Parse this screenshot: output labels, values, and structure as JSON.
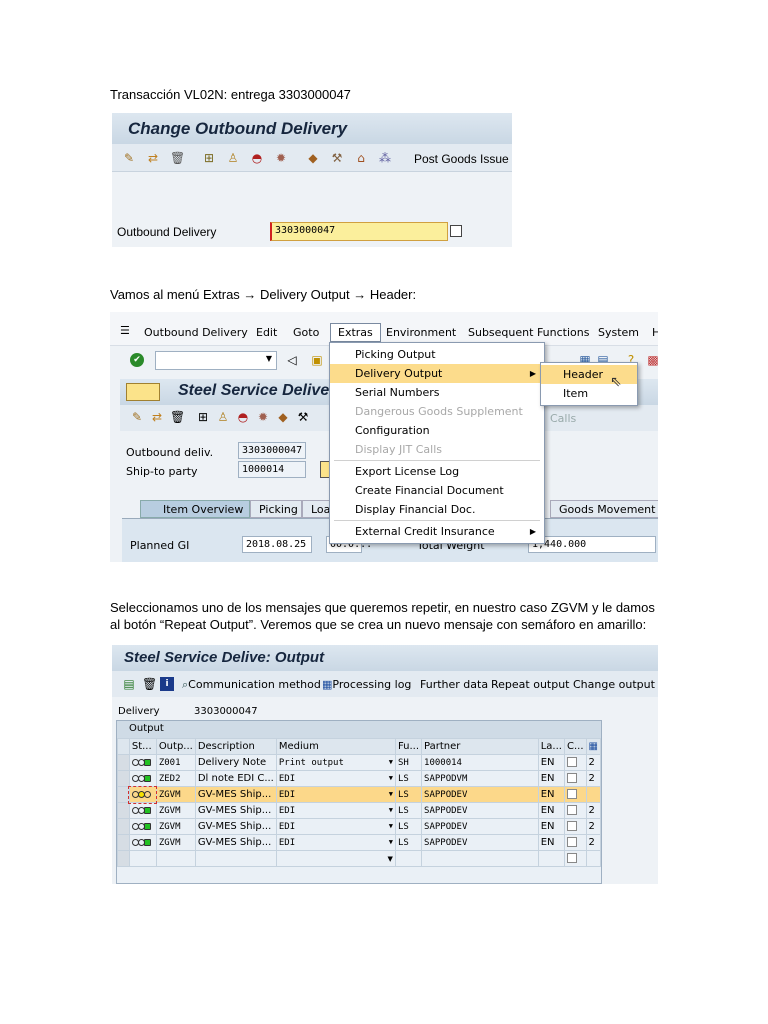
{
  "para1": "Transacción VL02N: entrega 3303000047",
  "shot1": {
    "title": "Change Outbound Delivery",
    "toolbar_icons": [
      "pencil-icon",
      "other-object-icon",
      "trash-icon",
      "document-flow-icon",
      "person-icon",
      "hat-icon",
      "fire-icon",
      "box-icon",
      "picking-icon",
      "house-icon",
      "grid-icon"
    ],
    "post_goods_issue": "Post Goods Issue",
    "field_label": "Outbound Delivery",
    "field_value": "3303000047"
  },
  "para2": "Vamos al menú Extras → Delivery Output → Header:",
  "shot2": {
    "menubar": [
      "Outbound Delivery",
      "Edit",
      "Goto",
      "Extras",
      "Environment",
      "Subsequent Functions",
      "System",
      "H"
    ],
    "title": "Steel Service Delive",
    "outbound_label": "Outbound deliv.",
    "outbound_value": "3303000047",
    "shipto_label": "Ship-to party",
    "shipto_value": "1000014",
    "tabs": [
      "Item Overview",
      "Picking",
      "Load",
      "Goods Movement Da"
    ],
    "planned_gi_label": "Planned GI",
    "planned_gi_date": "2018.08.25",
    "planned_gi_time": "00:0...",
    "total_weight_label": "Total Weight",
    "total_weight_value": "1,440.000",
    "calls_fragment": "Calls",
    "extras_menu": [
      {
        "label": "Picking Output",
        "enabled": true
      },
      {
        "label": "Delivery Output",
        "enabled": true,
        "submenu": true,
        "highlighted": true
      },
      {
        "label": "Serial Numbers",
        "enabled": true
      },
      {
        "label": "Dangerous Goods Supplement",
        "enabled": false
      },
      {
        "label": "Configuration",
        "enabled": true
      },
      {
        "label": "Display JIT Calls",
        "enabled": false
      },
      {
        "label": "Export License Log",
        "enabled": true
      },
      {
        "label": "Create Financial Document",
        "enabled": true
      },
      {
        "label": "Display Financial Doc.",
        "enabled": true
      },
      {
        "label": "External Credit Insurance",
        "enabled": true,
        "submenu": true
      }
    ],
    "submenu": [
      "Header",
      "Item"
    ]
  },
  "para3_line1": "Seleccionamos uno de los mensajes que queremos repetir, en nuestro caso ZGVM y le damos",
  "para3_line2": "al botón “Repeat Output”. Veremos que se crea un nuevo mensaje con semáforo en amarillo:",
  "shot3": {
    "title": "Steel Service Delive: Output",
    "toolbar": [
      "Communication method",
      "Processing log",
      "Further data",
      "Repeat output",
      "Change output"
    ],
    "delivery_label": "Delivery",
    "delivery_value": "3303000047",
    "group_title": "Output",
    "columns": [
      "St...",
      "Outp...",
      "Description",
      "Medium",
      "Fu...",
      "Partner",
      "La...",
      "C...",
      "I"
    ],
    "rows": [
      {
        "status": "green",
        "output": "Z001",
        "description": "Delivery Note",
        "medium": "Print output",
        "function": "SH",
        "partner": "1000014",
        "lang": "EN",
        "extra": "2"
      },
      {
        "status": "green",
        "output": "ZED2",
        "description": "Dl note EDI C...",
        "medium": "EDI",
        "function": "LS",
        "partner": "SAPPODVM",
        "lang": "EN",
        "extra": "2"
      },
      {
        "status": "yellow",
        "output": "ZGVM",
        "description": "GV-MES Ship...",
        "medium": "EDI",
        "function": "LS",
        "partner": "SAPPODEV",
        "lang": "EN",
        "extra": "",
        "selected": true
      },
      {
        "status": "green",
        "output": "ZGVM",
        "description": "GV-MES Ship...",
        "medium": "EDI",
        "function": "LS",
        "partner": "SAPPODEV",
        "lang": "EN",
        "extra": "2"
      },
      {
        "status": "green",
        "output": "ZGVM",
        "description": "GV-MES Ship...",
        "medium": "EDI",
        "function": "LS",
        "partner": "SAPPODEV",
        "lang": "EN",
        "extra": "2"
      },
      {
        "status": "green",
        "output": "ZGVM",
        "description": "GV-MES Ship...",
        "medium": "EDI",
        "function": "LS",
        "partner": "SAPPODEV",
        "lang": "EN",
        "extra": "2"
      }
    ]
  }
}
